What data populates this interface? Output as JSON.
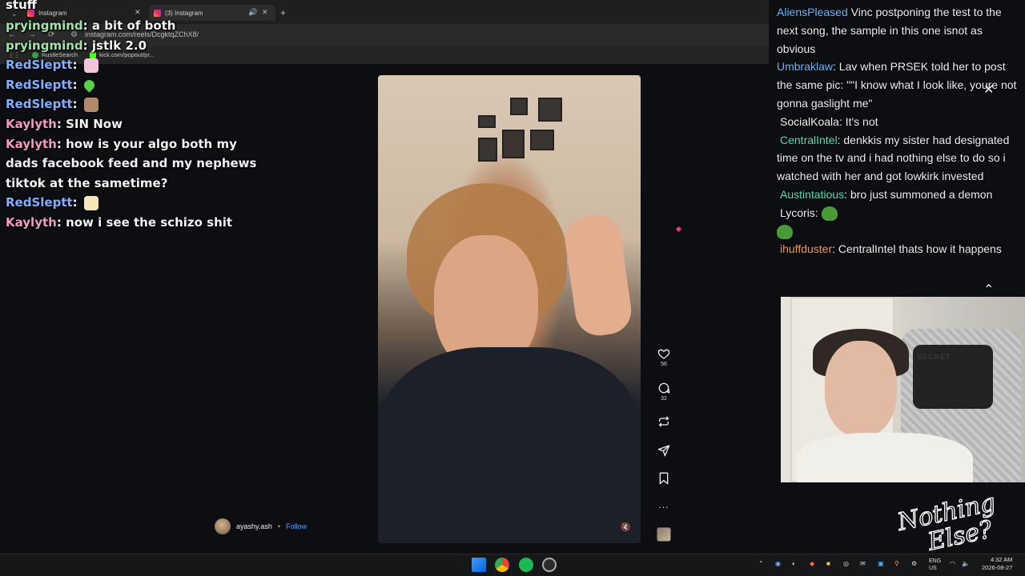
{
  "browser": {
    "tabs": [
      {
        "label": "Instagram",
        "active": false
      },
      {
        "label": "(3) Instagram",
        "active": true
      }
    ],
    "url": "instagram.com/reels/DcgktqZChX8/",
    "bookmarks": [
      "RustleSearch",
      "kick.com/popout/pr..."
    ]
  },
  "left_chat": {
    "top_fragment": "stuff",
    "messages": [
      {
        "user": "pryingmind",
        "text": "a bit of both",
        "color": "#9fe3a7"
      },
      {
        "user": "pryingmind",
        "text": "jstlk 2.0",
        "color": "#9fe3a7"
      },
      {
        "user": "RedSleptt",
        "text": "",
        "emote": "pink-bear-emote"
      },
      {
        "user": "RedSleptt",
        "text": "",
        "emote": "green-drop-emote"
      },
      {
        "user": "RedSleptt",
        "text": "",
        "emote": "bear-emote"
      },
      {
        "user": "Kaylyth",
        "text": "SIN Now",
        "color": "#f49ac1"
      },
      {
        "user": "Kaylyth",
        "text": "how is your algo both my dads facebook feed and my nephews tiktok at the sametime?",
        "color": "#f49ac1"
      },
      {
        "user": "RedSleptt",
        "text": "",
        "emote": "cat-emote"
      },
      {
        "user": "Kaylyth",
        "text": "now i see the schizo shit",
        "color": "#f49ac1"
      }
    ]
  },
  "reel": {
    "author": "ayashy.ash",
    "separator": "•",
    "follow_label": "Follow",
    "likes": "56",
    "comments": "32",
    "more": "..."
  },
  "right_chat": {
    "messages": [
      {
        "user": "AliensPleased",
        "text": "Vinc postponing the test to the next song, the sample in this one isnot as obvious",
        "color": "#5fb6ff"
      },
      {
        "user": "Umbraklaw",
        "text": "Lav when PRSEK told her to post the same pic: \"\"I know what I look like, youre not gonna gaslight me\"",
        "color": "#5fb6ff"
      },
      {
        "user": "SocialKoala",
        "text": "It's not",
        "color": "#f0f0f0"
      },
      {
        "user": "CentralIntel",
        "text": "denkkis my sister had designated time on the tv and i had nothing else to do so i watched with her and got lowkirk invested",
        "color": "#49e0b8"
      },
      {
        "user": "Austintatious",
        "text": "bro just summoned a demon",
        "color": "#49e0b8"
      },
      {
        "user": "Lycoris",
        "text": "",
        "color": "#f0f0f0"
      },
      {
        "user": "ihuffduster",
        "text": "CentralIntel thats how it happens",
        "color": "#f29b4a"
      }
    ]
  },
  "webcam": {
    "chair_brand": "SECRET"
  },
  "logo": {
    "line1": "Nothing",
    "line2": "Else?"
  },
  "taskbar": {
    "lang_top": "ENG",
    "lang_bottom": "US",
    "time": "4:32 AM",
    "date": "2026-08-27"
  }
}
